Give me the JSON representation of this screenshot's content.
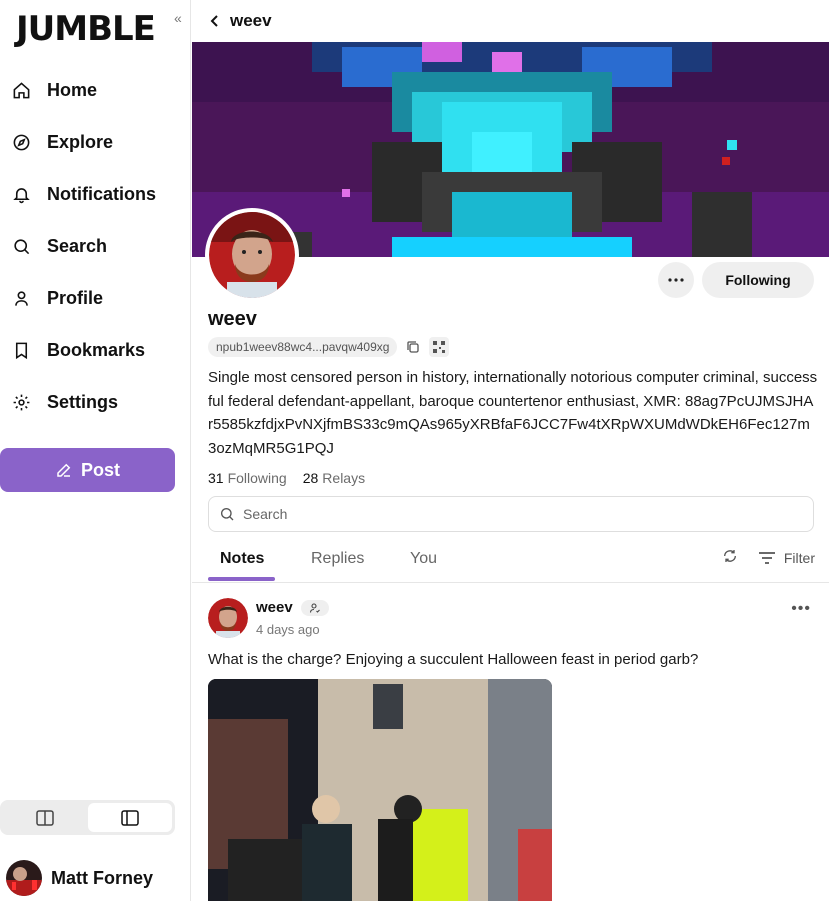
{
  "app": {
    "logo_text": "JUMBLE"
  },
  "sidebar": {
    "items": [
      {
        "label": "Home",
        "icon": "home-icon"
      },
      {
        "label": "Explore",
        "icon": "compass-icon"
      },
      {
        "label": "Notifications",
        "icon": "bell-icon"
      },
      {
        "label": "Search",
        "icon": "search-icon"
      },
      {
        "label": "Profile",
        "icon": "user-icon"
      },
      {
        "label": "Bookmarks",
        "icon": "bookmark-icon"
      },
      {
        "label": "Settings",
        "icon": "gear-icon"
      }
    ],
    "post_label": "Post",
    "account_name": "Matt Forney",
    "accent_color": "#8a63c9"
  },
  "header": {
    "title": "weev"
  },
  "profile": {
    "display_name": "weev",
    "npub": "npub1weev88wc4...pavqw409xg",
    "follow_label": "Following",
    "bio": "Single most censored person in history, internationally notorious computer criminal, successful federal defendant-appellant, baroque countertenor enthusiast, XMR: 88ag7PcUJMSJHAr5585kzfdjxPvNXjfmBS33c9mQAs965yXRBfaF6JCC7Fw4tXRpWXUMdWDkEH6Fec127m3ozMqMR5G1PQJ",
    "following_count": "31",
    "following_label": "Following",
    "relays_count": "28",
    "relays_label": "Relays"
  },
  "search": {
    "placeholder": "Search"
  },
  "tabs": [
    {
      "label": "Notes",
      "active": true
    },
    {
      "label": "Replies",
      "active": false
    },
    {
      "label": "You",
      "active": false
    }
  ],
  "filter_label": "Filter",
  "note": {
    "author": "weev",
    "time": "4 days ago",
    "text": "What is the charge? Enjoying a succulent Halloween feast in period garb?"
  }
}
